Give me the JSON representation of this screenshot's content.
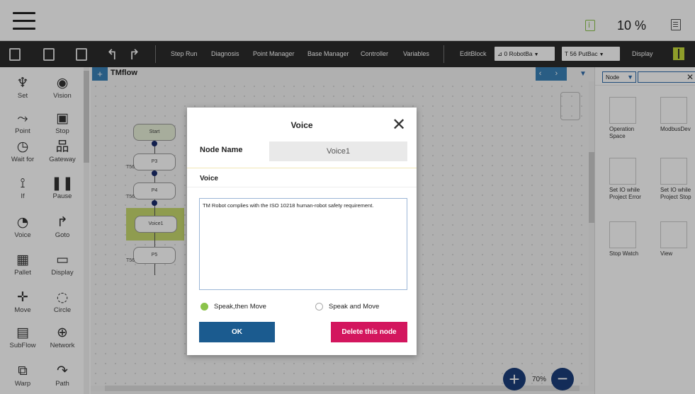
{
  "status": {
    "speed": "10 %"
  },
  "toolbar": {
    "step_run": "Step Run",
    "diagnosis": "Diagnosis",
    "point_manager": "Point Manager",
    "base_manager": "Base Manager",
    "controller": "Controller",
    "variables": "Variables",
    "editblock": "EditBlock",
    "robot_base": "0 RobotBa",
    "tool": "56 PutBac",
    "display": "Display"
  },
  "sidebar": {
    "items": [
      {
        "label": "Set",
        "icon": "set-icon"
      },
      {
        "label": "Vision",
        "icon": "vision-icon"
      },
      {
        "label": "Point",
        "icon": "point-icon"
      },
      {
        "label": "Stop",
        "icon": "stop-icon"
      },
      {
        "label": "Wait for",
        "icon": "wait-icon"
      },
      {
        "label": "Gateway",
        "icon": "gateway-icon"
      },
      {
        "label": "If",
        "icon": "if-icon"
      },
      {
        "label": "Pause",
        "icon": "pause-icon"
      },
      {
        "label": "Voice",
        "icon": "voice-icon"
      },
      {
        "label": "Goto",
        "icon": "goto-icon"
      },
      {
        "label": "Pallet",
        "icon": "pallet-icon"
      },
      {
        "label": "Display",
        "icon": "display-icon"
      },
      {
        "label": "Move",
        "icon": "move-icon"
      },
      {
        "label": "Circle",
        "icon": "circle-icon"
      },
      {
        "label": "SubFlow",
        "icon": "subflow-icon"
      },
      {
        "label": "Network",
        "icon": "network-icon"
      },
      {
        "label": "Warp",
        "icon": "warp-icon"
      },
      {
        "label": "Path",
        "icon": "path-icon"
      }
    ]
  },
  "canvas": {
    "tab": "TMflow",
    "zoom": "70%",
    "nodes": [
      "Start",
      "P3",
      "P4",
      "Voice1",
      "P5"
    ],
    "tags": [
      "T56",
      "T56",
      "T56"
    ]
  },
  "right_panel": {
    "filter": "Node",
    "tiles": [
      {
        "label": "Operation Space"
      },
      {
        "label": "ModbusDev"
      },
      {
        "label": "Set IO while Project Error"
      },
      {
        "label": "Set IO while Project Stop"
      },
      {
        "label": "Stop Watch"
      },
      {
        "label": "View"
      }
    ]
  },
  "dialog": {
    "title": "Voice",
    "node_name_label": "Node Name",
    "node_name_value": "Voice1",
    "voice_label": "Voice",
    "text": "TM Robot complies with the ISO 10218 human-robot safety requirement.",
    "option_1": "Speak,then Move",
    "option_2": "Speak and Move",
    "selected_option": "Speak,then Move",
    "ok": "OK",
    "delete": "Delete this node"
  },
  "colors": {
    "accent_blue": "#1b5b8f",
    "delete_pink": "#d3165e",
    "radio_green": "#8bc34a",
    "toolbar_dark": "#2b2b2b"
  }
}
